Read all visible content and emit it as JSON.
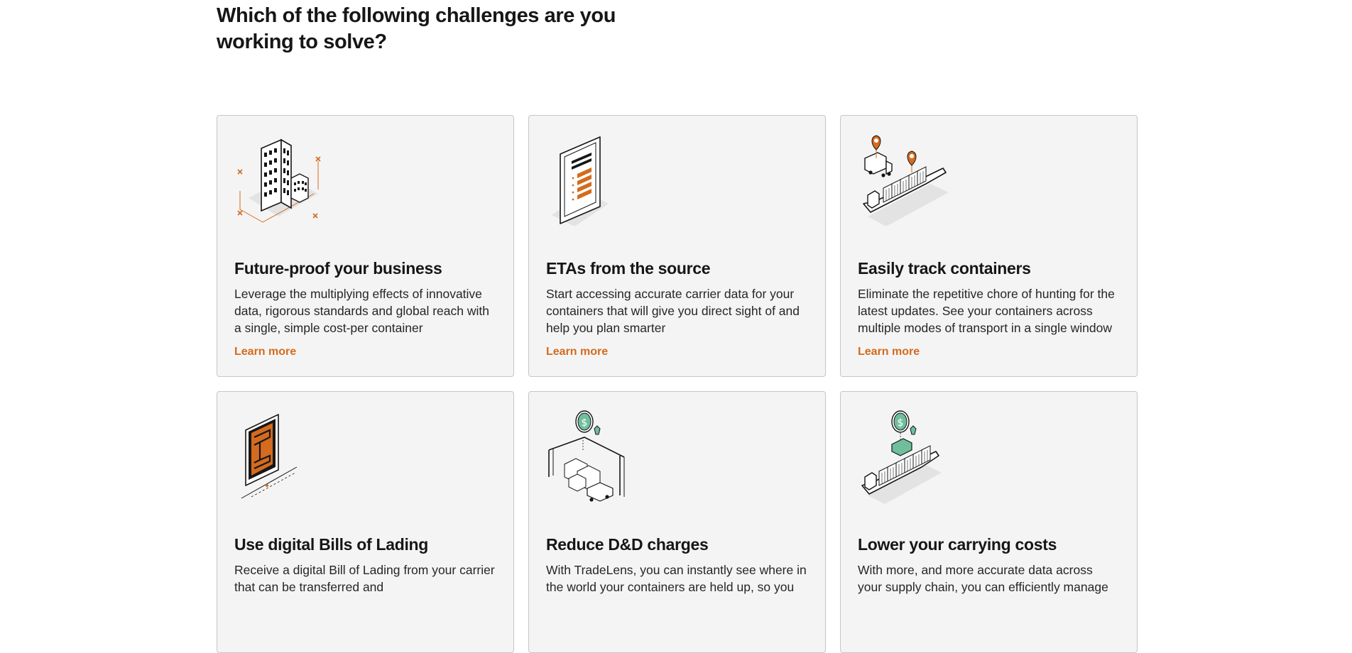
{
  "page": {
    "heading": "Which of the following challenges are you working to solve?"
  },
  "colors": {
    "accent_orange": "#d46b1e",
    "accent_green": "#6fbf9c",
    "card_background": "#f4f4f4",
    "card_border": "#c6c6c6",
    "text": "#161616"
  },
  "cards": [
    {
      "icon": "office-building-icon",
      "title": "Future-proof your business",
      "description": "Leverage the multiplying effects of innovative data, rigorous standards and global reach with a single, simple cost-per container",
      "link": "Learn more"
    },
    {
      "icon": "tablet-document-icon",
      "title": "ETAs from the source",
      "description": "Start accessing accurate carrier data for your containers that will give you direct sight of and help you plan smarter",
      "link": "Learn more"
    },
    {
      "icon": "ship-truck-location-icon",
      "title": "Easily track containers",
      "description": "Eliminate the repetitive chore of hunting for the latest updates. See your containers across multiple modes of transport in a single window",
      "link": "Learn more"
    },
    {
      "icon": "digital-document-icon",
      "title": "Use digital Bills of Lading",
      "description": "Receive a digital Bill of Lading from your carrier that can be transferred and",
      "link": ""
    },
    {
      "icon": "port-crane-coin-icon",
      "title": "Reduce D&D charges",
      "description": "With TradeLens, you can instantly see where in the world your containers are held up, so you",
      "link": ""
    },
    {
      "icon": "ship-coin-icon",
      "title": "Lower your carrying costs",
      "description": "With more, and more accurate data across your supply chain, you can efficiently manage",
      "link": ""
    }
  ]
}
